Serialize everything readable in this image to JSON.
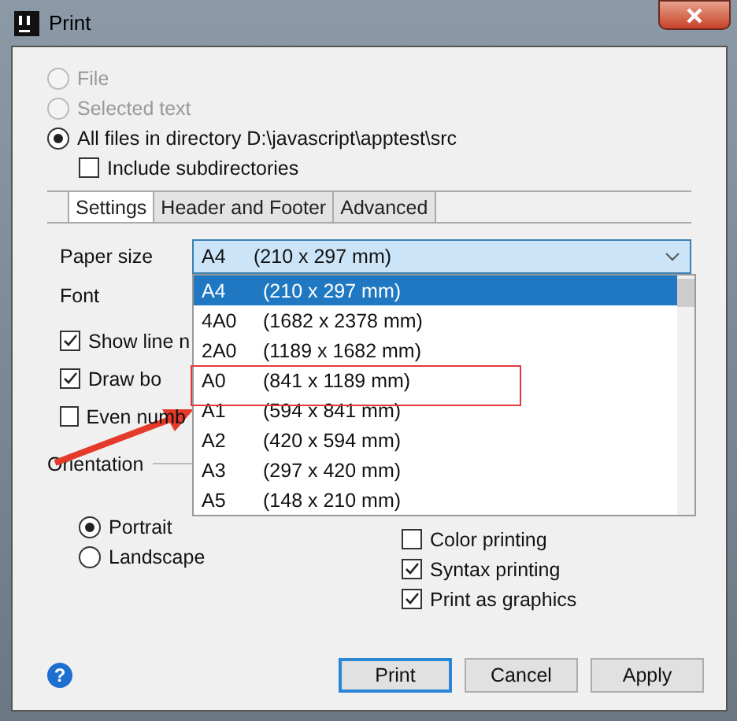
{
  "window": {
    "title": "Print"
  },
  "scope": [
    {
      "label": "File",
      "selected": false,
      "disabled": true
    },
    {
      "label": "Selected text",
      "selected": false,
      "disabled": true
    },
    {
      "label": "All files in directory D:\\javascript\\apptest\\src",
      "selected": true,
      "disabled": false
    }
  ],
  "include_subdirectories": {
    "label": "Include subdirectories",
    "checked": false
  },
  "tabs": [
    {
      "label": "Settings",
      "selected": true
    },
    {
      "label": "Header and Footer",
      "selected": false
    },
    {
      "label": "Advanced",
      "selected": false
    }
  ],
  "paper_size": {
    "label": "Paper size",
    "value": "A4",
    "dimensions": "(210 x 297 mm)",
    "options": [
      {
        "name": "A4",
        "dimensions": "(210 x 297 mm)",
        "selected": true
      },
      {
        "name": "4A0",
        "dimensions": "(1682 x 2378 mm)",
        "selected": false
      },
      {
        "name": "2A0",
        "dimensions": "(1189 x 1682 mm)",
        "selected": false
      },
      {
        "name": "A0",
        "dimensions": "(841 x 1189 mm)",
        "selected": false
      },
      {
        "name": "A1",
        "dimensions": "(594 x 841 mm)",
        "selected": false
      },
      {
        "name": "A2",
        "dimensions": "(420 x 594 mm)",
        "selected": false
      },
      {
        "name": "A3",
        "dimensions": "(297 x 420 mm)",
        "selected": false
      },
      {
        "name": "A5",
        "dimensions": "(148 x 210 mm)",
        "selected": false
      }
    ]
  },
  "font": {
    "label": "Font"
  },
  "left_options": [
    {
      "label": "Show line n",
      "checked": true
    },
    {
      "label": "Draw bo",
      "checked": true
    },
    {
      "label": "Even numb",
      "checked": false
    }
  ],
  "orientation": {
    "label": "Orientation",
    "options": [
      {
        "label": "Portrait",
        "selected": true
      },
      {
        "label": "Landscape",
        "selected": false
      }
    ]
  },
  "right_options": [
    {
      "label": "Color printing",
      "checked": false
    },
    {
      "label": "Syntax printing",
      "checked": true
    },
    {
      "label": "Print as graphics",
      "checked": true
    }
  ],
  "help": "?",
  "buttons": [
    {
      "label": "Print",
      "default": true
    },
    {
      "label": "Cancel",
      "default": false
    },
    {
      "label": "Apply",
      "default": false
    }
  ]
}
